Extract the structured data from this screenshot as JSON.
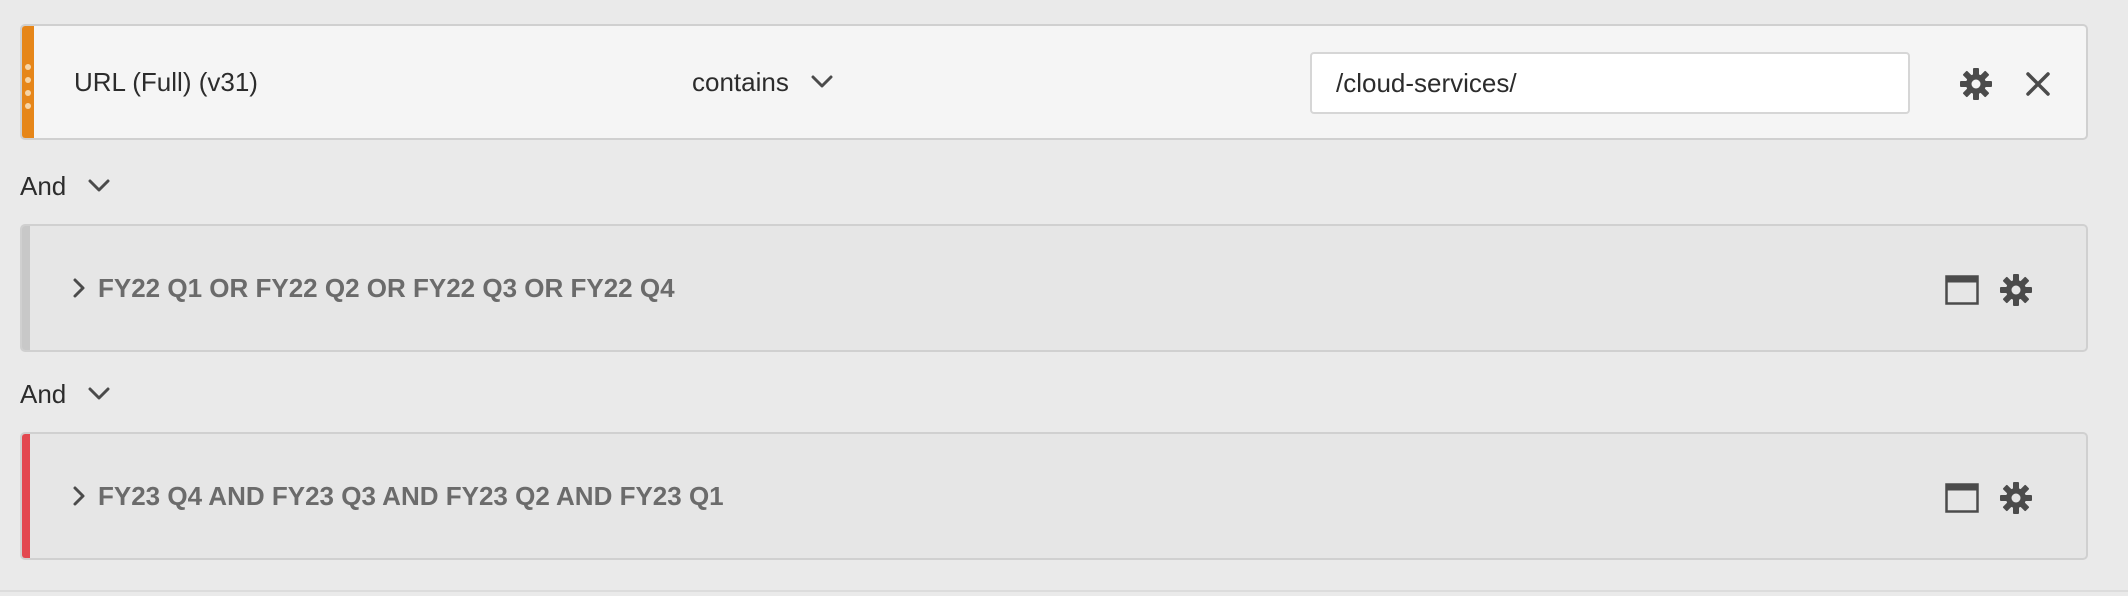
{
  "rule": {
    "dimension_label": "URL (Full) (v31)",
    "operator_label": "contains",
    "value": "/cloud-services/",
    "handle_color": "#e68619",
    "settings_icon": "gear-icon",
    "remove_icon": "close-icon"
  },
  "connectors": [
    {
      "label": "And"
    },
    {
      "label": "And"
    }
  ],
  "segments": [
    {
      "title": "FY22 Q1 OR FY22 Q2 OR FY22 Q3 OR FY22 Q4",
      "bar_color": "#c8c8c8",
      "icons": [
        "window-icon",
        "gear-icon"
      ]
    },
    {
      "title": "FY23 Q4 AND FY23 Q3 AND FY23 Q2 AND FY23 Q1",
      "bar_color": "#e34850",
      "icons": [
        "window-icon",
        "gear-icon"
      ]
    }
  ]
}
